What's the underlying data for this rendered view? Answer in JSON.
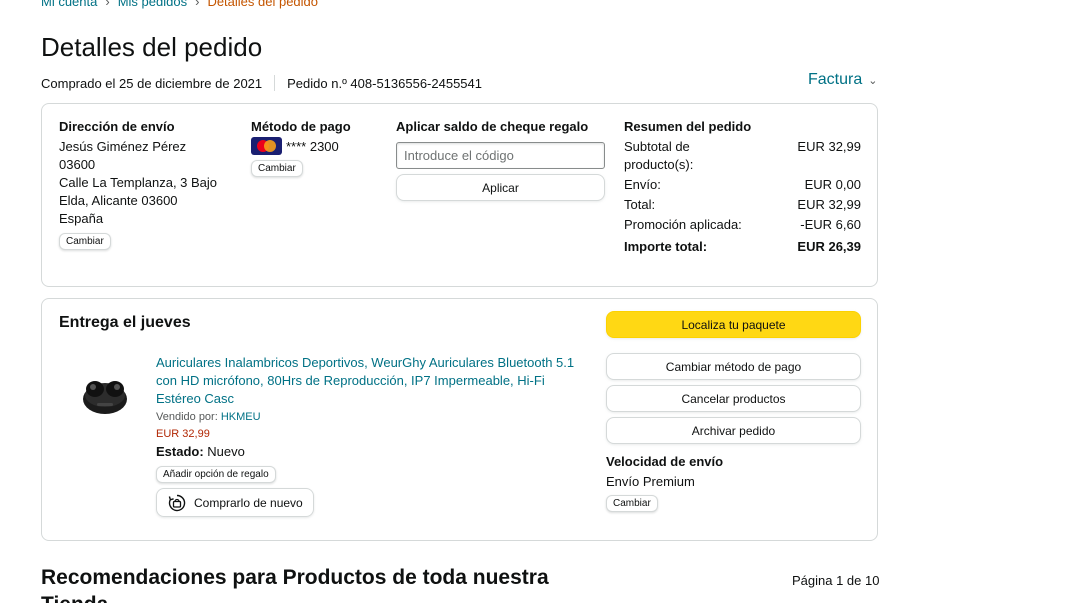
{
  "breadcrumb": {
    "items": [
      "Mi cuenta",
      "Mis pedidos"
    ],
    "current": "Detalles del pedido",
    "separator": "›"
  },
  "page": {
    "title": "Detalles del pedido",
    "purchased": "Comprado el 25 de diciembre de 2021",
    "order_number": "Pedido n.º 408-5136556-2455541",
    "invoice_label": "Factura",
    "invoice_chevron": "⌄"
  },
  "shipping": {
    "title": "Dirección de envío",
    "lines": [
      "Jesús Giménez Pérez",
      "03600",
      "Calle La Templanza, 3 Bajo",
      "Elda, Alicante 03600",
      "España"
    ],
    "change_label": "Cambiar"
  },
  "payment": {
    "title": "Método de pago",
    "card_icon": "mastercard-icon",
    "card_number": "**** 2300",
    "change_label": "Cambiar"
  },
  "gift_card": {
    "title": "Aplicar saldo de cheque regalo",
    "placeholder": "Introduce el código",
    "value": "",
    "apply_label": "Aplicar"
  },
  "summary": {
    "title": "Resumen del pedido",
    "rows": [
      {
        "label": "Subtotal de producto(s):",
        "value": "EUR 32,99"
      },
      {
        "label": "Envío:",
        "value": "EUR 0,00"
      },
      {
        "label": "Total:",
        "value": "EUR 32,99"
      },
      {
        "label": "Promoción aplicada:",
        "value": "-EUR 6,60"
      }
    ],
    "total_label": "Importe total:",
    "total_value": "EUR 26,39"
  },
  "delivery": {
    "title": "Entrega el jueves",
    "product": {
      "name": "Auriculares Inalambricos Deportivos, WeurGhy Auriculares Bluetooth 5.1 con HD micrófono, 80Hrs de Reproducción, IP7 Impermeable, Hi-Fi Estéreo Casc",
      "sold_by_label": "Vendido por:",
      "seller": "HKMEU",
      "price": "EUR 32,99",
      "state_label": "Estado:",
      "state_value": "Nuevo",
      "gift_option_label": "Añadir opción de regalo",
      "rebuy_label": "Comprarlo de nuevo"
    },
    "actions": {
      "track": "Localiza tu paquete",
      "change_payment": "Cambiar método de pago",
      "cancel": "Cancelar productos",
      "archive": "Archivar pedido"
    },
    "speed_title": "Velocidad de envío",
    "speed_value": "Envío Premium",
    "speed_change_label": "Cambiar"
  },
  "recommendations": {
    "title": "Recomendaciones para Productos de toda nuestra Tienda",
    "page_indicator": "Página 1 de 10"
  },
  "colors": {
    "link": "#007185",
    "primary_button": "#FFD814",
    "price": "#B12704",
    "breadcrumb_current": "#C45500"
  }
}
